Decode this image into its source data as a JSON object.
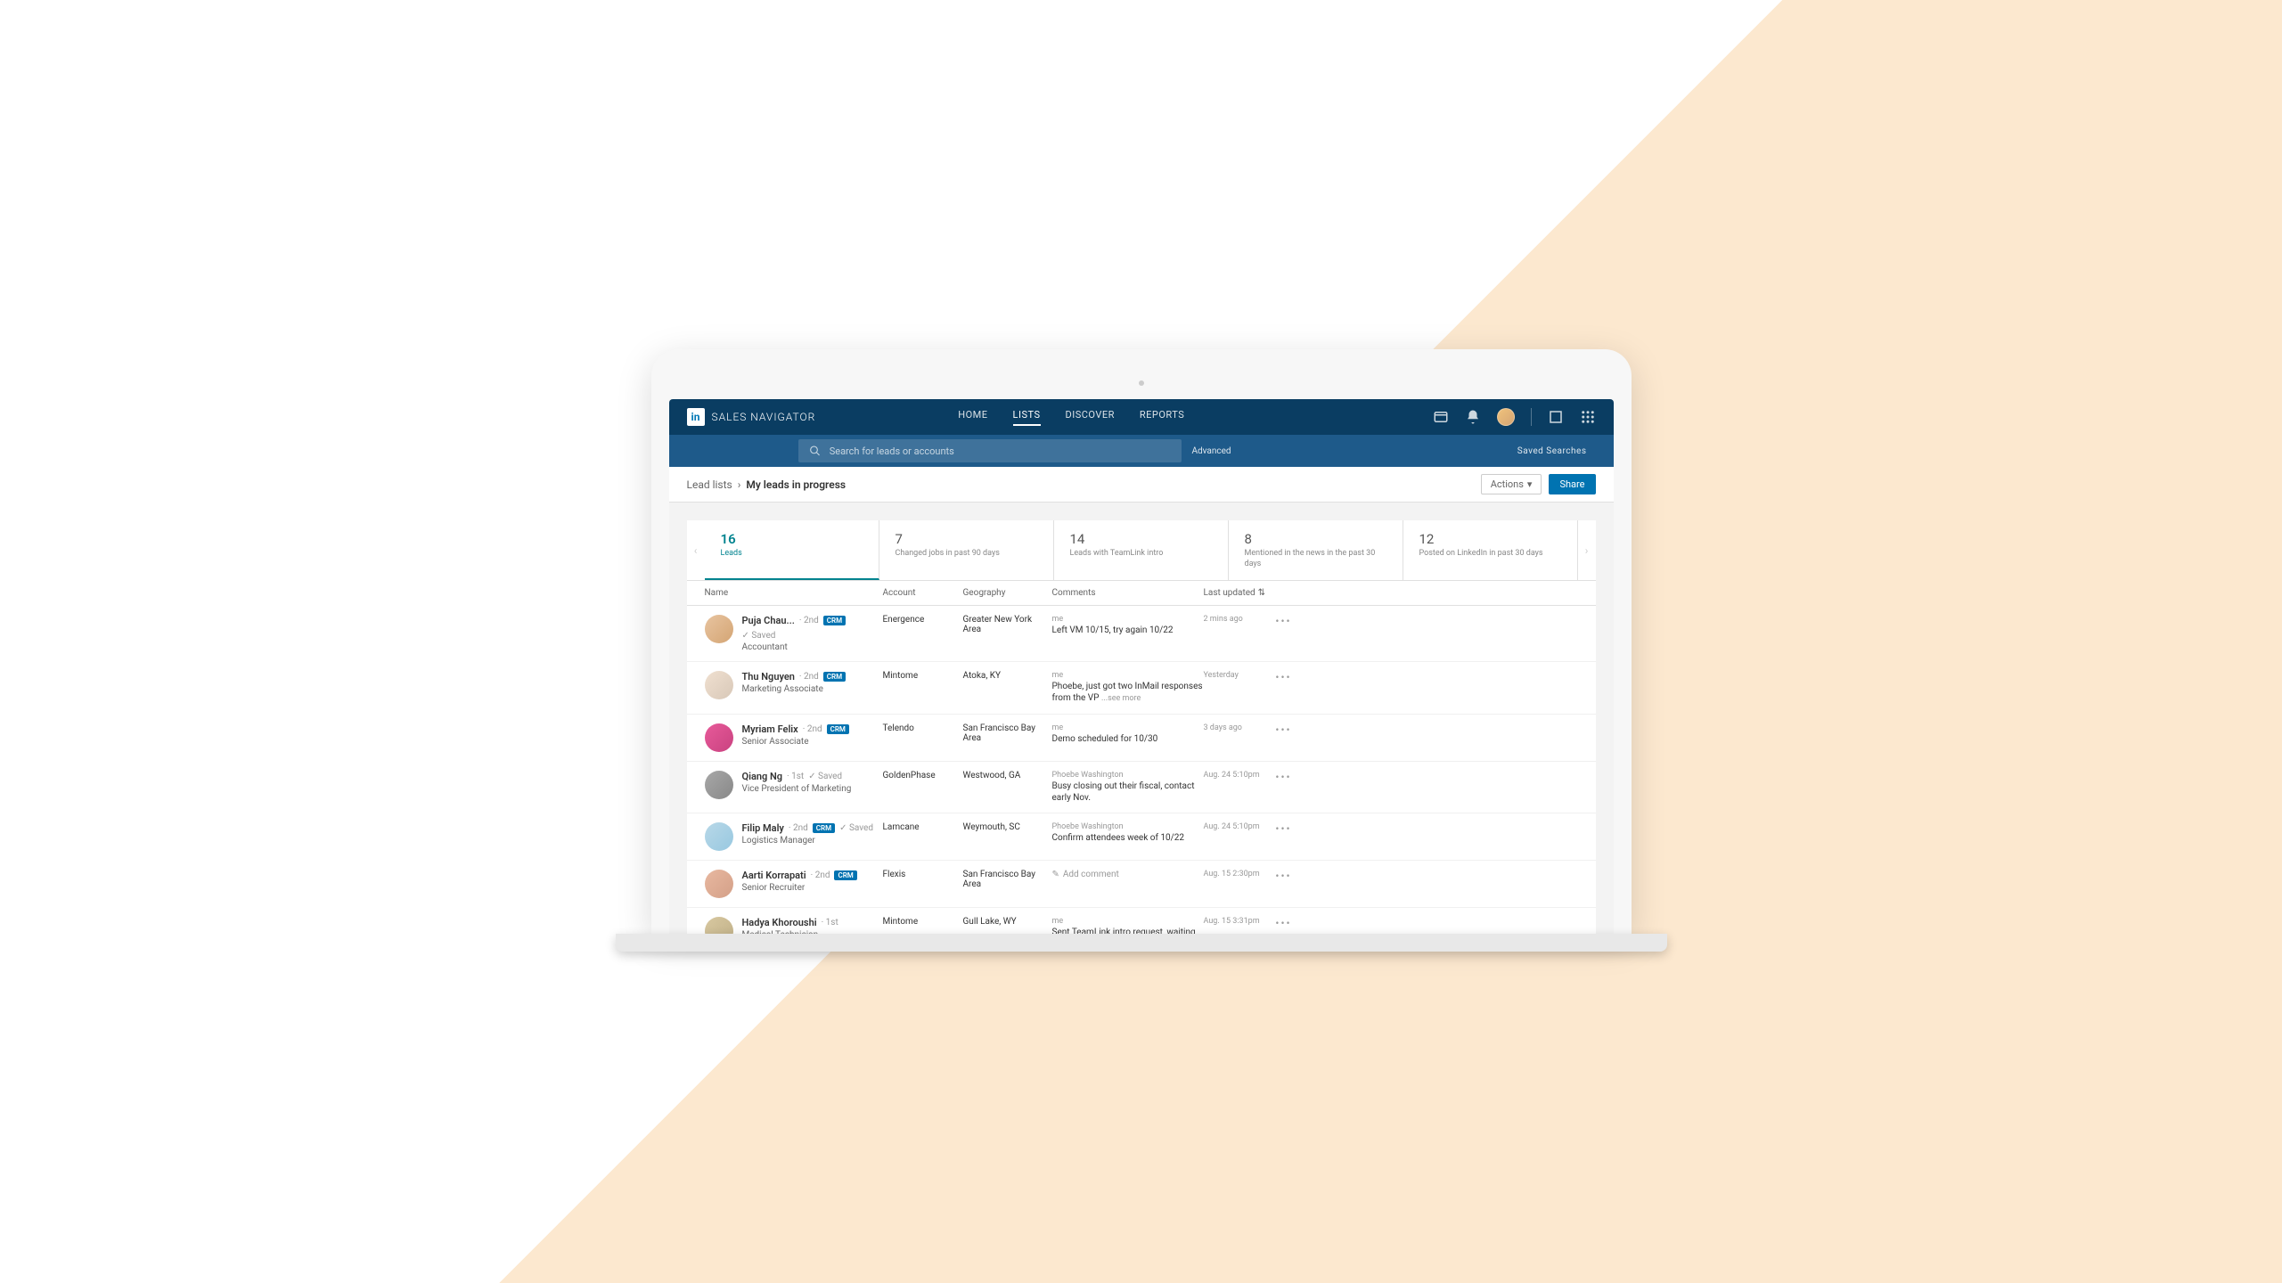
{
  "header": {
    "logo_text": "SALES NAVIGATOR",
    "nav": [
      "HOME",
      "LISTS",
      "DISCOVER",
      "REPORTS"
    ],
    "active_nav_index": 1
  },
  "search": {
    "placeholder": "Search for leads or accounts",
    "advanced": "Advanced",
    "saved_searches": "Saved  Searches"
  },
  "breadcrumb": {
    "parent": "Lead lists",
    "current": "My leads in progress"
  },
  "actions": {
    "actions_label": "Actions",
    "share_label": "Share"
  },
  "tabs": [
    {
      "num": "16",
      "label": "Leads",
      "active": true
    },
    {
      "num": "7",
      "label": "Changed jobs in past 90 days"
    },
    {
      "num": "14",
      "label": "Leads with TeamLink intro"
    },
    {
      "num": "8",
      "label": "Mentioned in the news in the past 30 days"
    },
    {
      "num": "12",
      "label": "Posted on LinkedIn in past 30 days"
    }
  ],
  "columns": {
    "name": "Name",
    "account": "Account",
    "geography": "Geography",
    "comments": "Comments",
    "last_updated": "Last updated"
  },
  "rows": [
    {
      "avatar": "linear-gradient(135deg,#e8c4a0,#d4a574)",
      "name": "Puja Chau...",
      "degree": "2nd",
      "crm": true,
      "saved": true,
      "title": "Accountant",
      "account": "Energence",
      "geo": "Greater New York Area",
      "author": "me",
      "comment": "Left VM 10/15, try again 10/22",
      "updated": "2 mins ago"
    },
    {
      "avatar": "linear-gradient(135deg,#f0e0d0,#d8c8b8)",
      "name": "Thu Nguyen",
      "degree": "2nd",
      "crm": true,
      "saved": false,
      "title": "Marketing Associate",
      "account": "Mintome",
      "geo": "Atoka, KY",
      "author": "me",
      "comment": "Phoebe, just got two InMail responses from the VP",
      "seemore": true,
      "updated": "Yesterday"
    },
    {
      "avatar": "linear-gradient(135deg,#e85a9a,#c94280)",
      "name": "Myriam Felix",
      "degree": "2nd",
      "crm": true,
      "saved": false,
      "title": "Senior Associate",
      "account": "Telendo",
      "geo": "San Francisco Bay Area",
      "author": "me",
      "comment": "Demo scheduled for 10/30",
      "updated": "3 days ago"
    },
    {
      "avatar": "linear-gradient(135deg,#a8a8a8,#888888)",
      "name": "Qiang Ng",
      "degree": "1st",
      "crm": false,
      "saved": true,
      "title": "Vice President of Marketing",
      "account": "GoldenPhase",
      "geo": "Westwood, GA",
      "author": "Phoebe Washington",
      "comment": "Busy closing out their fiscal, contact early Nov.",
      "updated": "Aug. 24  5:10pm"
    },
    {
      "avatar": "linear-gradient(135deg,#b8d8e8,#98c8e0)",
      "name": "Filip Maly",
      "degree": "2nd",
      "crm": true,
      "saved": true,
      "title": "Logistics Manager",
      "account": "Lamcane",
      "geo": "Weymouth, SC",
      "author": "Phoebe Washington",
      "comment": "Confirm attendees week of 10/22",
      "updated": "Aug. 24  5:10pm"
    },
    {
      "avatar": "linear-gradient(135deg,#e8b8a0,#d4a088)",
      "name": "Aarti Korrapati",
      "degree": "2nd",
      "crm": true,
      "saved": false,
      "title": "Senior Recruiter",
      "account": "Flexis",
      "geo": "San Francisco Bay Area",
      "author": "",
      "comment": "",
      "add_comment": "Add comment",
      "updated": "Aug. 15  2:30pm"
    },
    {
      "avatar": "linear-gradient(135deg,#d8c8a0,#c0b088)",
      "name": "Hadya Khoroushi",
      "degree": "1st",
      "crm": false,
      "saved": false,
      "title": "Medical Technician",
      "account": "Mintome",
      "geo": "Gull Lake, WY",
      "author": "me",
      "comment": "Sent TeamLink intro request, waiting to hear back",
      "updated": "Aug. 15  3:31pm"
    }
  ],
  "see_more_text": "...see more"
}
